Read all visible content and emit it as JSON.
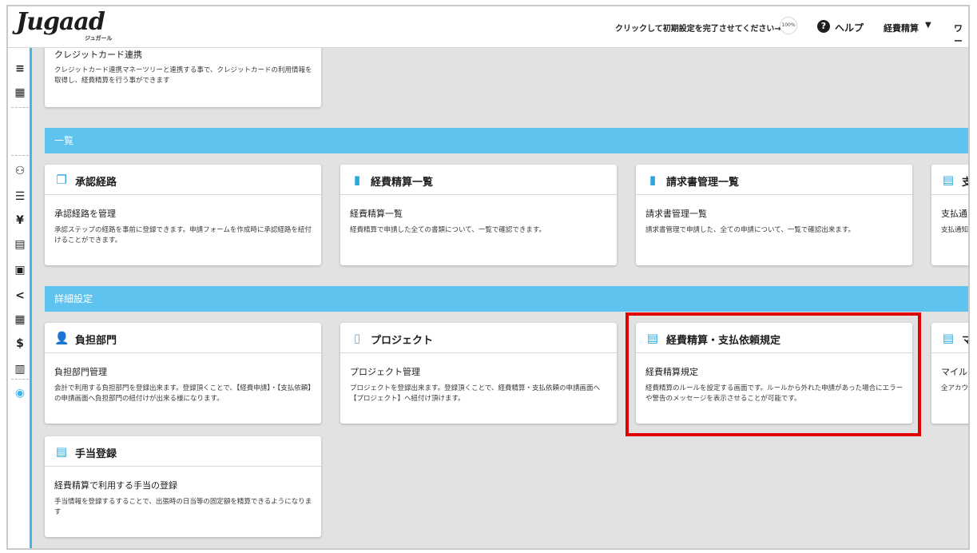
{
  "header": {
    "logo": "Jugaad",
    "logo_sub": "ジュガール",
    "setup_text": "クリックして初期設定を完了させてください→",
    "progress": "100%",
    "help_icon": "question-circle-icon",
    "help": "ヘルプ",
    "menu": "経費精算",
    "menu_cut": "ワー"
  },
  "sidebar": {
    "icons": [
      "collapse-menu-icon",
      "building-icon",
      "users-icon",
      "list-icon",
      "yen-icon",
      "document-icon",
      "receipt-icon",
      "share-icon",
      "grid-icon",
      "dollar-file-icon",
      "book-icon",
      "globe-icon"
    ]
  },
  "sections": {
    "list": "一覧",
    "detail": "詳細設定"
  },
  "cards": {
    "credit": {
      "title": "クレジットカード連携",
      "desc": "クレジットカード連携マネーツリーと連携する事で、クレジットカードの利用情報を取得し、経費精算を行う事ができます"
    },
    "approval": {
      "title": "承認経路",
      "subtitle": "承認経路を管理",
      "desc": "承認ステップの経路を事前に登録できます。申請フォームを作成時に承認経路を紐付けることができます。"
    },
    "expense_list": {
      "title": "経費精算一覧",
      "subtitle": "経費精算一覧",
      "desc": "経費精算で申請した全ての書類について、一覧で確認できます。"
    },
    "invoice_list": {
      "title": "請求書管理一覧",
      "subtitle": "請求書管理一覧",
      "desc": "請求書管理で申請した、全ての申請について、一覧で確認出来ます。"
    },
    "payment_cut": {
      "title": "支",
      "subtitle": "支払通",
      "desc": "支払通知"
    },
    "department": {
      "title": "負担部門",
      "subtitle": "負担部門管理",
      "desc": "会計で利用する負担部門を登録出来ます。登録頂くことで、【経費申請】・【支払依頼】の申請画面へ負担部門の紐付けが出来る様になります。"
    },
    "project": {
      "title": "プロジェクト",
      "subtitle": "プロジェクト管理",
      "desc": "プロジェクトを登録出来ます。登録頂くことで、経費精算・支払依頼の申請画面へ【プロジェクト】へ紐付け頂けます。"
    },
    "rules": {
      "title": "経費精算・支払依頼規定",
      "subtitle": "経費精算規定",
      "desc": "経費精算のルールを設定する画面です。ルールから外れた申請があった場合にエラーや警告のメッセージを表示させることが可能です。"
    },
    "mileage_cut": {
      "title": "マ",
      "subtitle": "マイル",
      "desc": "全アカウ"
    },
    "allowance": {
      "title": "手当登録",
      "subtitle": "経費精算で利用する手当の登録",
      "desc": "手当情報を登録するすることで、出張時の日当等の固定額を精算できるようになります"
    }
  },
  "colors": {
    "accent": "#5ec3ef",
    "icon": "#2aa6dd",
    "highlight": "#e00000"
  }
}
